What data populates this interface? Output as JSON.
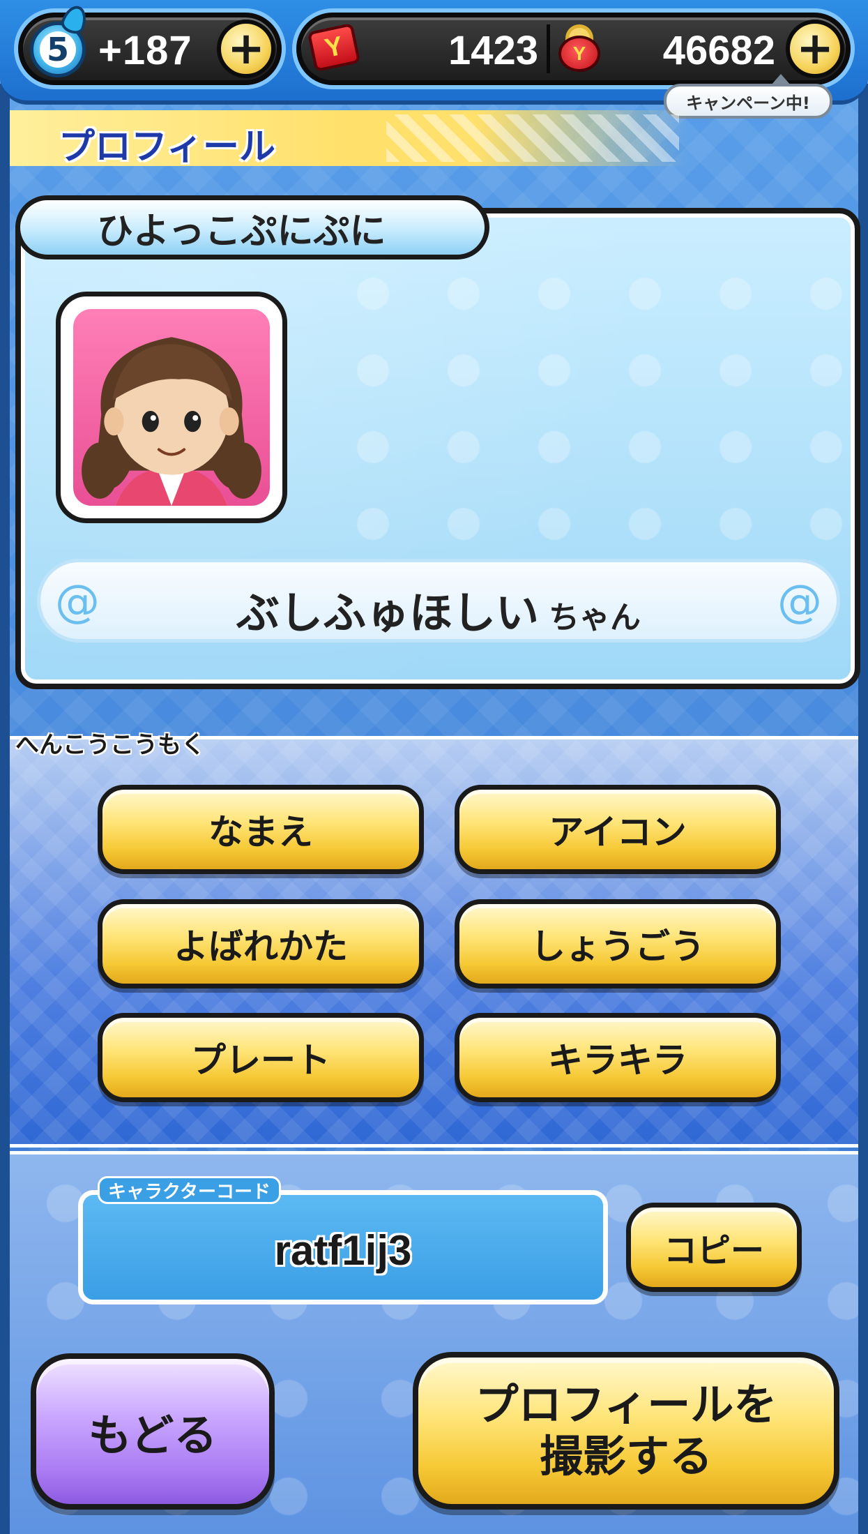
{
  "topbar": {
    "level": "5",
    "stamina": "+187",
    "stamina_plus": "+",
    "ticket_icon_glyph": "Y",
    "tickets": "1423",
    "money_icon_glyph": "Y",
    "money": "46682",
    "money_plus": "+",
    "campaign_label": "キャンペーン中!"
  },
  "section": {
    "title": "プロフィール"
  },
  "profile": {
    "rank": "ひよっこぷにぷに",
    "avatar_icon": "girl-avatar-icon",
    "name": "ぶしふゅほしい",
    "name_suffix": "ちゃん"
  },
  "changes": {
    "label": "へんこうこうもく",
    "buttons": [
      "なまえ",
      "アイコン",
      "よばれかた",
      "しょうごう",
      "プレート",
      "キラキラ"
    ]
  },
  "character_code": {
    "label": "キャラクターコード",
    "value": "ratf1ij3",
    "copy_label": "コピー"
  },
  "footer": {
    "back_label": "もどる",
    "photo_label_line1": "プロフィールを",
    "photo_label_line2": "撮影する"
  },
  "colors": {
    "accent_yellow": "#f6c935",
    "header_blue": "#1d3aa8",
    "back_purple": "#a878f2",
    "card_blue": "#9fd8f7"
  }
}
